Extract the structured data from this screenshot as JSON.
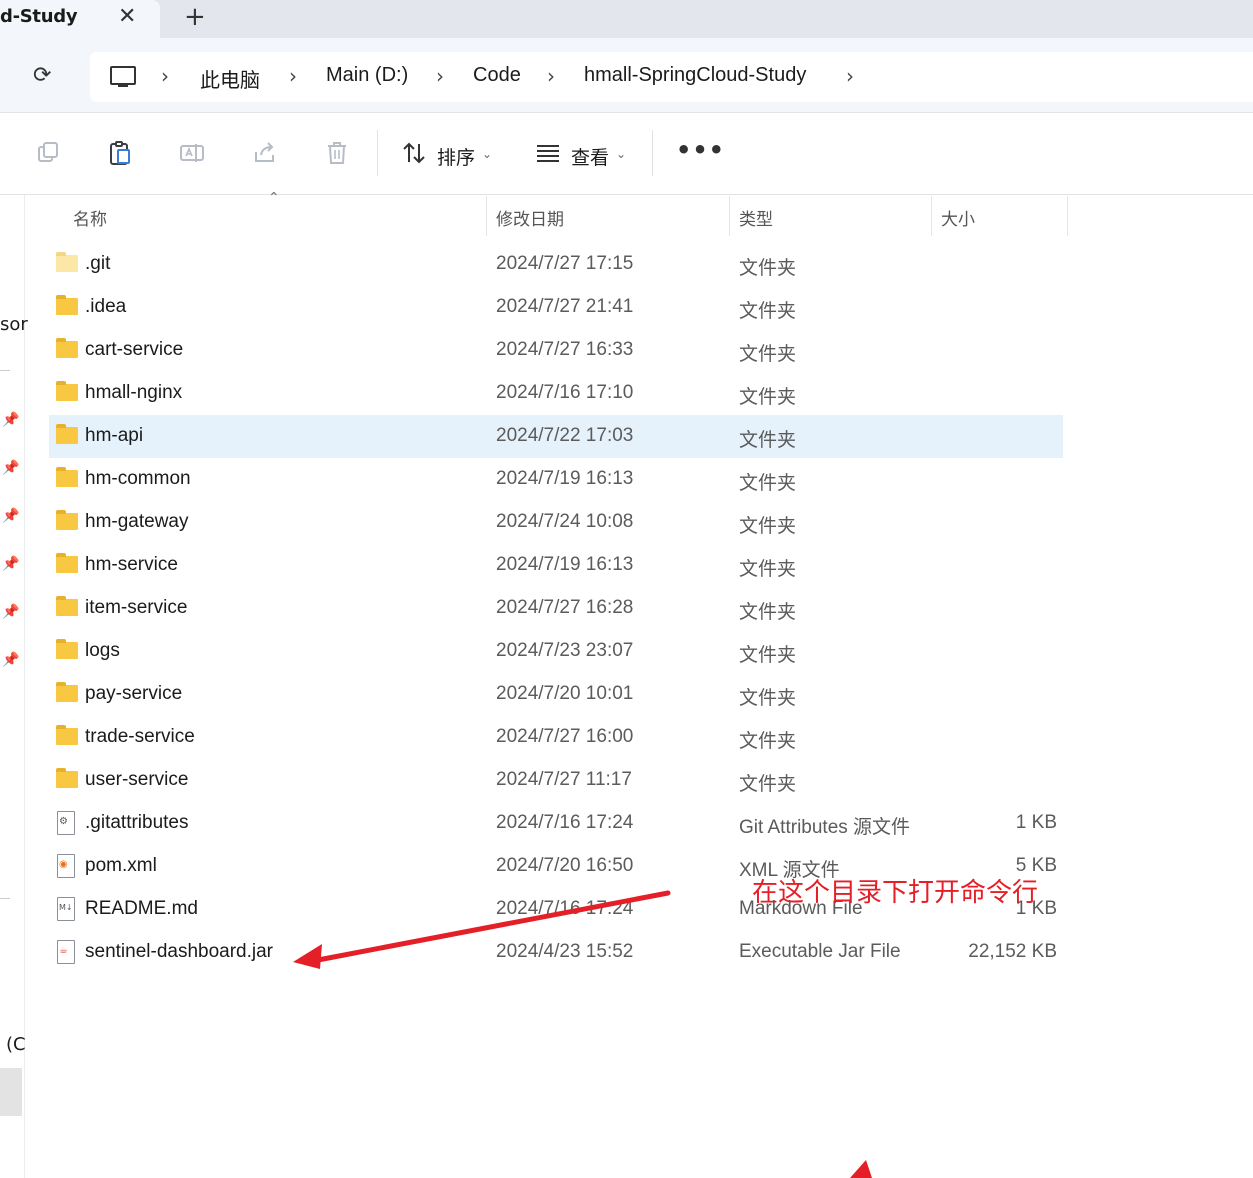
{
  "tab": {
    "title": "d-Study",
    "close_label": "✕",
    "new_label": "+"
  },
  "nav": {
    "refresh_label": "⟳",
    "breadcrumbs": [
      "此电脑",
      "Main (D:)",
      "Code",
      "hmall-SpringCloud-Study"
    ],
    "separator": "›"
  },
  "toolbar": {
    "sort_label": "排序",
    "view_label": "查看",
    "more_label": "•••",
    "caret": "⌄",
    "icons": [
      "copy-icon",
      "paste-icon",
      "rename-icon",
      "share-icon",
      "delete-icon",
      "sort-icon",
      "view-icon",
      "more-icon"
    ]
  },
  "leftpane": {
    "fragment_top": "sor",
    "fragment_bottom": "(C",
    "pin_glyph": "📌"
  },
  "columns": {
    "name": "名称",
    "modified": "修改日期",
    "type": "类型",
    "size": "大小",
    "sort_indicator": "⌃"
  },
  "files": [
    {
      "name": ".git",
      "date": "2024/7/27 17:15",
      "type": "文件夹",
      "size": "",
      "icon": "folder-icon",
      "light": true
    },
    {
      "name": ".idea",
      "date": "2024/7/27 21:41",
      "type": "文件夹",
      "size": "",
      "icon": "folder-icon"
    },
    {
      "name": "cart-service",
      "date": "2024/7/27 16:33",
      "type": "文件夹",
      "size": "",
      "icon": "folder-icon"
    },
    {
      "name": "hmall-nginx",
      "date": "2024/7/16 17:10",
      "type": "文件夹",
      "size": "",
      "icon": "folder-icon"
    },
    {
      "name": "hm-api",
      "date": "2024/7/22 17:03",
      "type": "文件夹",
      "size": "",
      "icon": "folder-icon",
      "selected": true
    },
    {
      "name": "hm-common",
      "date": "2024/7/19 16:13",
      "type": "文件夹",
      "size": "",
      "icon": "folder-icon"
    },
    {
      "name": "hm-gateway",
      "date": "2024/7/24 10:08",
      "type": "文件夹",
      "size": "",
      "icon": "folder-icon"
    },
    {
      "name": "hm-service",
      "date": "2024/7/19 16:13",
      "type": "文件夹",
      "size": "",
      "icon": "folder-icon"
    },
    {
      "name": "item-service",
      "date": "2024/7/27 16:28",
      "type": "文件夹",
      "size": "",
      "icon": "folder-icon"
    },
    {
      "name": "logs",
      "date": "2024/7/23 23:07",
      "type": "文件夹",
      "size": "",
      "icon": "folder-icon"
    },
    {
      "name": "pay-service",
      "date": "2024/7/20 10:01",
      "type": "文件夹",
      "size": "",
      "icon": "folder-icon"
    },
    {
      "name": "trade-service",
      "date": "2024/7/27 16:00",
      "type": "文件夹",
      "size": "",
      "icon": "folder-icon"
    },
    {
      "name": "user-service",
      "date": "2024/7/27 11:17",
      "type": "文件夹",
      "size": "",
      "icon": "folder-icon"
    },
    {
      "name": ".gitattributes",
      "date": "2024/7/16 17:24",
      "type": "Git Attributes 源文件",
      "size": "1 KB",
      "icon": "settings-file-icon",
      "glyph": "⚙"
    },
    {
      "name": "pom.xml",
      "date": "2024/7/20 16:50",
      "type": "XML 源文件",
      "size": "5 KB",
      "icon": "rss-file-icon",
      "glyph": "◉"
    },
    {
      "name": "README.md",
      "date": "2024/7/16 17:24",
      "type": "Markdown File",
      "size": "1 KB",
      "icon": "markdown-file-icon",
      "glyph": "M↓"
    },
    {
      "name": "sentinel-dashboard.jar",
      "date": "2024/4/23 15:52",
      "type": "Executable Jar File",
      "size": "22,152 KB",
      "icon": "java-jar-icon",
      "glyph": "☕"
    }
  ],
  "annotation": {
    "text": "在这个目录下打开命令行",
    "color": "#e51f27"
  },
  "colors": {
    "selected_row": "#e5f1fb",
    "folder": "#f9c843",
    "accent": "#e51f27"
  }
}
